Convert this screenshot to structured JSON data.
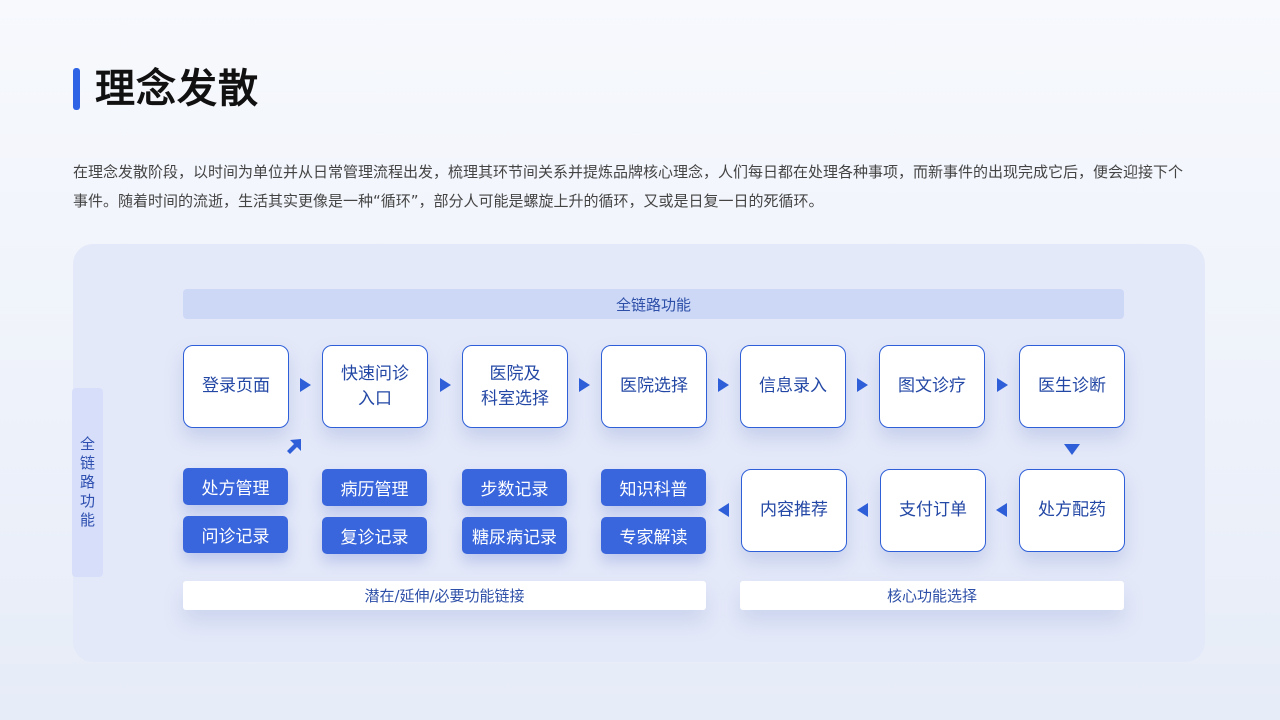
{
  "title": "理念发散",
  "description": "在理念发散阶段，以时间为单位并从日常管理流程出发，梳理其环节间关系并提炼品牌核心理念，人们每日都在处理各种事项，而新事件的出现完成它后，便会迎接下个事件。随着时间的流逝，生活其实更像是一种“循环”，部分人可能是螺旋上升的循环，又或是日复一日的死循环。",
  "side_label": "全链路功能",
  "top_bar": "全链路功能",
  "row1": [
    {
      "label": "登录页面"
    },
    {
      "label": "快速问诊\n入口"
    },
    {
      "label": "医院及\n科室选择"
    },
    {
      "label": "医院选择"
    },
    {
      "label": "信息录入"
    },
    {
      "label": "图文诊疗"
    },
    {
      "label": "医生诊断"
    }
  ],
  "row2_nodes": [
    {
      "label": "内容推荐"
    },
    {
      "label": "支付订单"
    },
    {
      "label": "处方配药"
    }
  ],
  "chips": [
    {
      "label": "处方管理"
    },
    {
      "label": "问诊记录"
    },
    {
      "label": "病历管理"
    },
    {
      "label": "复诊记录"
    },
    {
      "label": "步数记录"
    },
    {
      "label": "糖尿病记录"
    },
    {
      "label": "知识科普"
    },
    {
      "label": "专家解读"
    }
  ],
  "bottom_left": "潜在/延伸/必要功能链接",
  "bottom_right": "核心功能选择",
  "colors": {
    "accent": "#2e5fd8",
    "chip": "#3a66dd",
    "panel": "#e4e9f9",
    "band": "#cdd8f7",
    "text_blue": "#2347a4"
  }
}
